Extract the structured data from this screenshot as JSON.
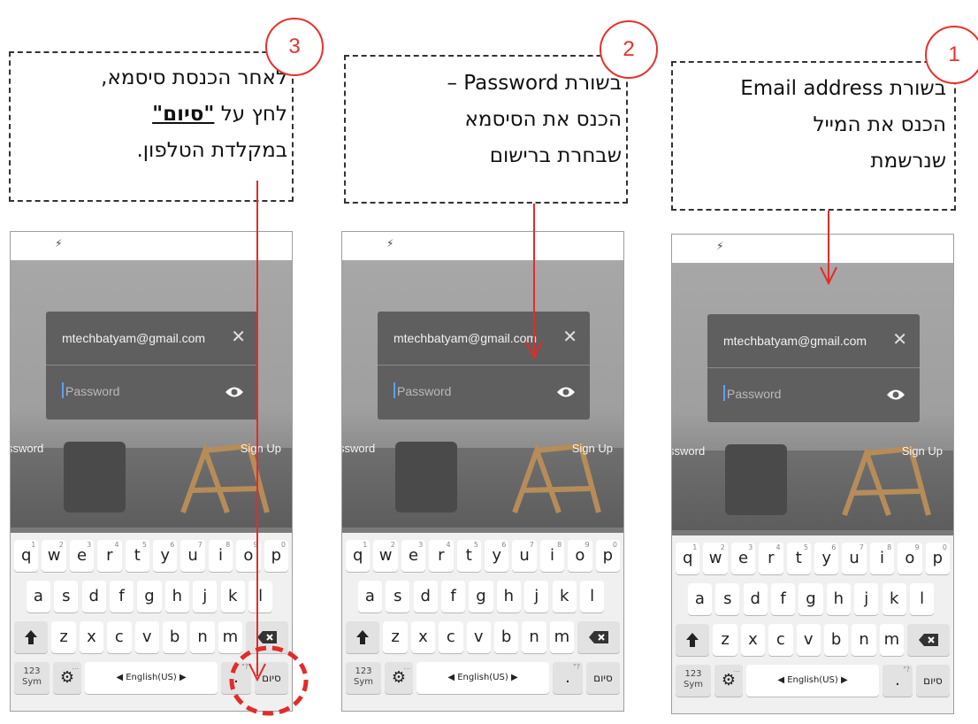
{
  "steps": [
    {
      "number": "1",
      "lines": [
        "בשורת Email address",
        "הכנס את המייל",
        "שנרשמת"
      ]
    },
    {
      "number": "2",
      "lines": [
        "בשורת Password –",
        "הכנס את הסיסמא",
        "שבחרת ברישום"
      ]
    },
    {
      "number": "3",
      "line1": "לאחר הכנסת סיסמא,",
      "line2_prefix": "לחץ על ",
      "line2_bold": "\"סיום\"",
      "line3": "במקלדת הטלפון."
    }
  ],
  "login_screen": {
    "email_value": "mtechbatyam@gmail.com",
    "password_placeholder": "Password",
    "forgot_link": "ssword",
    "signup_link": "Sign Up",
    "status_icon": "flash-icon"
  },
  "keyboard": {
    "row1": [
      {
        "k": "q",
        "n": "1"
      },
      {
        "k": "w",
        "n": "2"
      },
      {
        "k": "e",
        "n": "3"
      },
      {
        "k": "r",
        "n": "4"
      },
      {
        "k": "t",
        "n": "5"
      },
      {
        "k": "y",
        "n": "6"
      },
      {
        "k": "u",
        "n": "7"
      },
      {
        "k": "i",
        "n": "8"
      },
      {
        "k": "o",
        "n": "9"
      },
      {
        "k": "p",
        "n": "0"
      }
    ],
    "row2": [
      "a",
      "s",
      "d",
      "f",
      "g",
      "h",
      "j",
      "k",
      "l"
    ],
    "row3": [
      "z",
      "x",
      "c",
      "v",
      "b",
      "n",
      "m"
    ],
    "sym_top": "123",
    "sym_bottom": "Sym",
    "settings_dots": "...",
    "language": "◀  English(US)  ▶",
    "period": ".",
    "period_sup": "\"?",
    "done": "סיום",
    "icons": {
      "shift": "shift-icon",
      "backspace": "backspace-icon",
      "settings": "gear-icon"
    }
  },
  "colors": {
    "accent_red": "#e32b2b",
    "number_circle": "#e8322a"
  }
}
